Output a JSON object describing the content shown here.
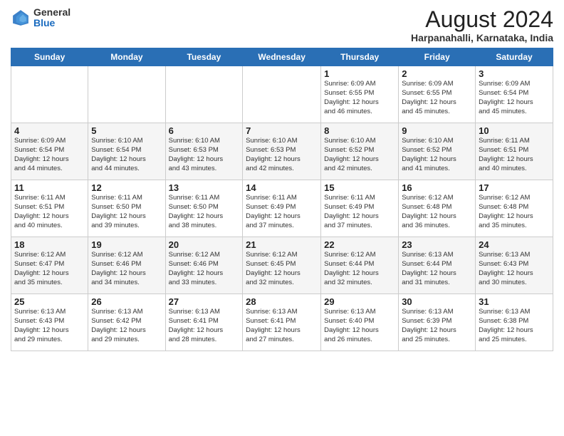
{
  "header": {
    "logo_general": "General",
    "logo_blue": "Blue",
    "month": "August 2024",
    "location": "Harpanahalli, Karnataka, India"
  },
  "days_of_week": [
    "Sunday",
    "Monday",
    "Tuesday",
    "Wednesday",
    "Thursday",
    "Friday",
    "Saturday"
  ],
  "weeks": [
    [
      {
        "day": "",
        "info": ""
      },
      {
        "day": "",
        "info": ""
      },
      {
        "day": "",
        "info": ""
      },
      {
        "day": "",
        "info": ""
      },
      {
        "day": "1",
        "info": "Sunrise: 6:09 AM\nSunset: 6:55 PM\nDaylight: 12 hours\nand 46 minutes."
      },
      {
        "day": "2",
        "info": "Sunrise: 6:09 AM\nSunset: 6:55 PM\nDaylight: 12 hours\nand 45 minutes."
      },
      {
        "day": "3",
        "info": "Sunrise: 6:09 AM\nSunset: 6:54 PM\nDaylight: 12 hours\nand 45 minutes."
      }
    ],
    [
      {
        "day": "4",
        "info": "Sunrise: 6:09 AM\nSunset: 6:54 PM\nDaylight: 12 hours\nand 44 minutes."
      },
      {
        "day": "5",
        "info": "Sunrise: 6:10 AM\nSunset: 6:54 PM\nDaylight: 12 hours\nand 44 minutes."
      },
      {
        "day": "6",
        "info": "Sunrise: 6:10 AM\nSunset: 6:53 PM\nDaylight: 12 hours\nand 43 minutes."
      },
      {
        "day": "7",
        "info": "Sunrise: 6:10 AM\nSunset: 6:53 PM\nDaylight: 12 hours\nand 42 minutes."
      },
      {
        "day": "8",
        "info": "Sunrise: 6:10 AM\nSunset: 6:52 PM\nDaylight: 12 hours\nand 42 minutes."
      },
      {
        "day": "9",
        "info": "Sunrise: 6:10 AM\nSunset: 6:52 PM\nDaylight: 12 hours\nand 41 minutes."
      },
      {
        "day": "10",
        "info": "Sunrise: 6:11 AM\nSunset: 6:51 PM\nDaylight: 12 hours\nand 40 minutes."
      }
    ],
    [
      {
        "day": "11",
        "info": "Sunrise: 6:11 AM\nSunset: 6:51 PM\nDaylight: 12 hours\nand 40 minutes."
      },
      {
        "day": "12",
        "info": "Sunrise: 6:11 AM\nSunset: 6:50 PM\nDaylight: 12 hours\nand 39 minutes."
      },
      {
        "day": "13",
        "info": "Sunrise: 6:11 AM\nSunset: 6:50 PM\nDaylight: 12 hours\nand 38 minutes."
      },
      {
        "day": "14",
        "info": "Sunrise: 6:11 AM\nSunset: 6:49 PM\nDaylight: 12 hours\nand 37 minutes."
      },
      {
        "day": "15",
        "info": "Sunrise: 6:11 AM\nSunset: 6:49 PM\nDaylight: 12 hours\nand 37 minutes."
      },
      {
        "day": "16",
        "info": "Sunrise: 6:12 AM\nSunset: 6:48 PM\nDaylight: 12 hours\nand 36 minutes."
      },
      {
        "day": "17",
        "info": "Sunrise: 6:12 AM\nSunset: 6:48 PM\nDaylight: 12 hours\nand 35 minutes."
      }
    ],
    [
      {
        "day": "18",
        "info": "Sunrise: 6:12 AM\nSunset: 6:47 PM\nDaylight: 12 hours\nand 35 minutes."
      },
      {
        "day": "19",
        "info": "Sunrise: 6:12 AM\nSunset: 6:46 PM\nDaylight: 12 hours\nand 34 minutes."
      },
      {
        "day": "20",
        "info": "Sunrise: 6:12 AM\nSunset: 6:46 PM\nDaylight: 12 hours\nand 33 minutes."
      },
      {
        "day": "21",
        "info": "Sunrise: 6:12 AM\nSunset: 6:45 PM\nDaylight: 12 hours\nand 32 minutes."
      },
      {
        "day": "22",
        "info": "Sunrise: 6:12 AM\nSunset: 6:44 PM\nDaylight: 12 hours\nand 32 minutes."
      },
      {
        "day": "23",
        "info": "Sunrise: 6:13 AM\nSunset: 6:44 PM\nDaylight: 12 hours\nand 31 minutes."
      },
      {
        "day": "24",
        "info": "Sunrise: 6:13 AM\nSunset: 6:43 PM\nDaylight: 12 hours\nand 30 minutes."
      }
    ],
    [
      {
        "day": "25",
        "info": "Sunrise: 6:13 AM\nSunset: 6:43 PM\nDaylight: 12 hours\nand 29 minutes."
      },
      {
        "day": "26",
        "info": "Sunrise: 6:13 AM\nSunset: 6:42 PM\nDaylight: 12 hours\nand 29 minutes."
      },
      {
        "day": "27",
        "info": "Sunrise: 6:13 AM\nSunset: 6:41 PM\nDaylight: 12 hours\nand 28 minutes."
      },
      {
        "day": "28",
        "info": "Sunrise: 6:13 AM\nSunset: 6:41 PM\nDaylight: 12 hours\nand 27 minutes."
      },
      {
        "day": "29",
        "info": "Sunrise: 6:13 AM\nSunset: 6:40 PM\nDaylight: 12 hours\nand 26 minutes."
      },
      {
        "day": "30",
        "info": "Sunrise: 6:13 AM\nSunset: 6:39 PM\nDaylight: 12 hours\nand 25 minutes."
      },
      {
        "day": "31",
        "info": "Sunrise: 6:13 AM\nSunset: 6:38 PM\nDaylight: 12 hours\nand 25 minutes."
      }
    ]
  ]
}
